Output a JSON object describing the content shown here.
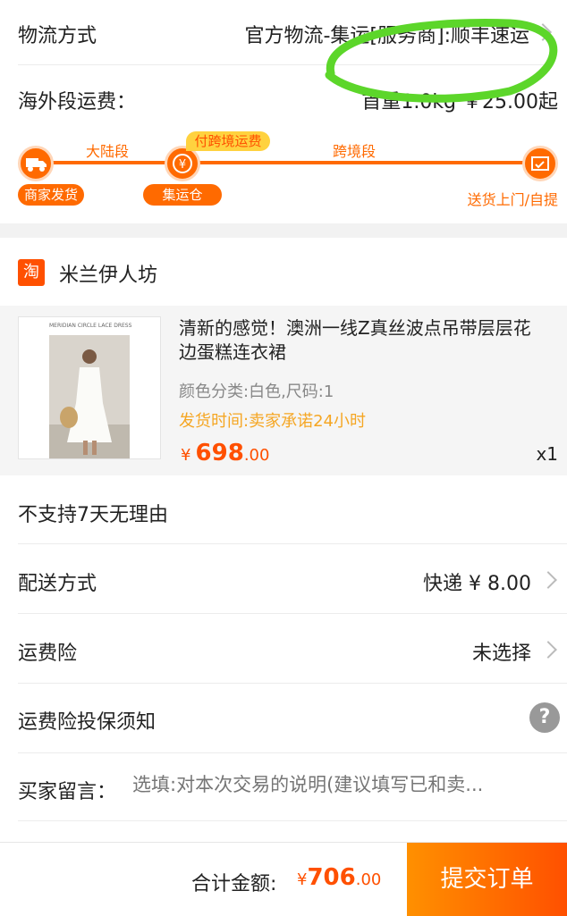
{
  "logistics": {
    "label": "物流方式",
    "value": "官方物流-集运[服务商]:顺丰速运",
    "fee_label": "海外段运费：",
    "fee_value": "首重1.0kg ￥25.00起"
  },
  "route": {
    "segment_mainland": "大陆段",
    "segment_cross": "跨境段",
    "badge": "付跨境运费",
    "node_start": "商家发货",
    "node_mid": "集运仓",
    "node_end": "送货上门/自提",
    "accent": "#ff6a00",
    "highlight_color": "#5cd62a"
  },
  "shop": {
    "icon_text": "淘",
    "name": "米兰伊人坊"
  },
  "product": {
    "image_caption": "MERIDIAN CIRCLE LACE DRESS",
    "title": "清新的感觉！澳洲一线Z真丝波点吊带层层花边蛋糕连衣裙",
    "sku": "颜色分类:白色,尺码:1",
    "ship_time": "发货时间:卖家承诺24小时",
    "price_symbol": "¥",
    "price_int": "698",
    "price_dec": ".00",
    "qty": "x1"
  },
  "options": {
    "no_return": "不支持7天无理由",
    "delivery_label": "配送方式",
    "delivery_value": "快递 ¥ 8.00",
    "insurance_label": "运费险",
    "insurance_value": "未选择",
    "insurance_notice_label": "运费险投保须知",
    "help_icon": "?",
    "message_label": "买家留言：",
    "message_placeholder": "选填:对本次交易的说明(建议填写已和卖..."
  },
  "footer": {
    "total_label": "合计金额:",
    "total_symbol": "¥",
    "total_int": "706",
    "total_dec": ".00",
    "submit_label": "提交订单"
  }
}
